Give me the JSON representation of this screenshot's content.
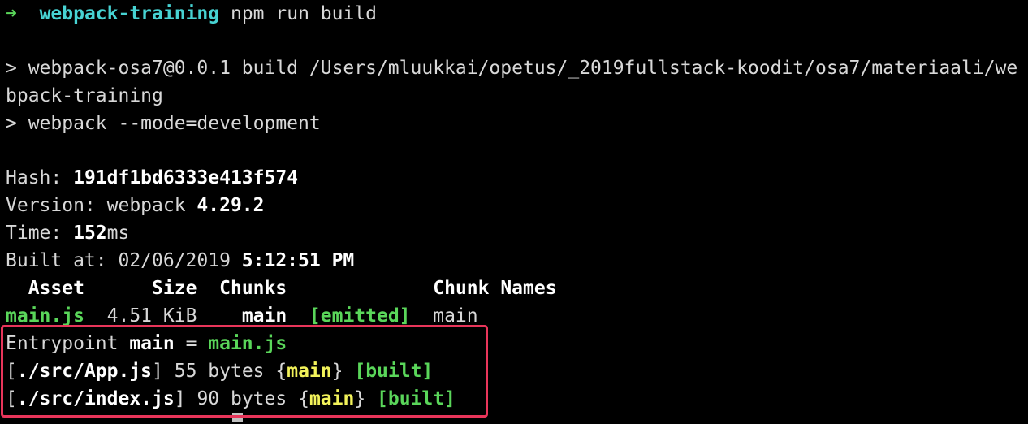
{
  "prompt": {
    "arrow": "➜",
    "directory": "webpack-training",
    "command": "npm run build"
  },
  "npm_output": {
    "line1": "> webpack-osa7@0.0.1 build /Users/mluukkai/opetus/_2019fullstack-koodit/osa7/materiaali/we",
    "line2": "bpack-training",
    "line3": "> webpack --mode=development"
  },
  "build_info": {
    "hash_label": "Hash: ",
    "hash_value": "191df1bd6333e413f574",
    "version_label": "Version: webpack ",
    "version_value": "4.29.2",
    "time_label": "Time: ",
    "time_value": "152",
    "time_unit": "ms",
    "built_at_label": "Built at: 02/06/2019 ",
    "built_at_time": "5:12:51 PM"
  },
  "asset_table": {
    "headers": {
      "asset": "Asset",
      "size": "Size",
      "chunks": "Chunks",
      "chunk_names": "Chunk Names"
    },
    "rows": [
      {
        "asset": "main.js",
        "size": "4.51 KiB",
        "chunks": "main",
        "status": "[emitted]",
        "chunk_names": "main"
      }
    ]
  },
  "entrypoint": {
    "label": "Entrypoint ",
    "name": "main",
    "equals": " = ",
    "file": "main.js"
  },
  "modules": [
    {
      "open": "[",
      "path": "./src/App.js",
      "close": "]",
      "size": " 55 bytes ",
      "brace_open": "{",
      "chunk": "main",
      "brace_close": "}",
      "status": "[built]"
    },
    {
      "open": "[",
      "path": "./src/index.js",
      "close": "]",
      "size": " 90 bytes ",
      "brace_open": "{",
      "chunk": "main",
      "brace_close": "}",
      "status": "[built]"
    }
  ],
  "colors": {
    "background": "#000000",
    "text": "#d8d8d8",
    "green": "#5ad65a",
    "cyan": "#47d3d3",
    "yellow": "#f2f25a",
    "highlight_border": "#e8355a"
  }
}
